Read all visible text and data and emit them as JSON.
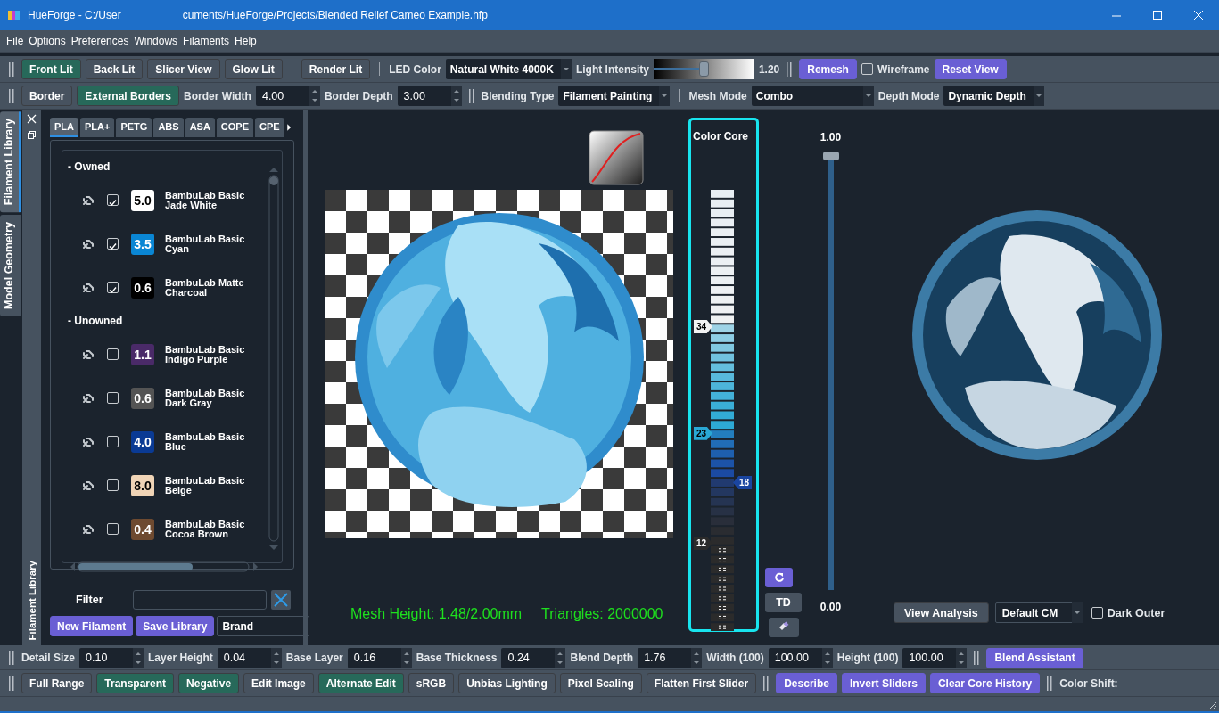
{
  "window": {
    "title": "HueForge - C:/User",
    "title_tail": "cuments/HueForge/Projects/Blended Relief Cameo Example.hfp"
  },
  "menu": [
    "File",
    "Options",
    "Preferences",
    "Windows",
    "Filaments",
    "Help"
  ],
  "view_toolbar": [
    {
      "kind": "grip"
    },
    {
      "kind": "toggle",
      "label": "Front Lit",
      "on": true
    },
    {
      "kind": "toggle",
      "label": "Back Lit",
      "on": false
    },
    {
      "kind": "toggle",
      "label": "Slicer View",
      "on": false
    },
    {
      "kind": "toggle",
      "label": "Glow Lit",
      "on": false
    },
    {
      "kind": "sep"
    },
    {
      "kind": "toggle",
      "label": "Render Lit",
      "on": false
    },
    {
      "kind": "sep"
    },
    {
      "kind": "label",
      "text": "LED Color"
    },
    {
      "kind": "dropdown",
      "value": "Natural White 4000K"
    },
    {
      "kind": "label",
      "text": "Light Intensity"
    },
    {
      "kind": "slider",
      "level": 0.5
    },
    {
      "kind": "label",
      "text": "1.20"
    },
    {
      "kind": "grip"
    },
    {
      "kind": "action",
      "label": "Remesh"
    },
    {
      "kind": "checkbox",
      "label": "Wireframe",
      "checked": false
    },
    {
      "kind": "action",
      "label": "Reset View"
    }
  ],
  "mesh_toolbar": [
    {
      "kind": "grip"
    },
    {
      "kind": "toggle",
      "label": "Border",
      "on": false
    },
    {
      "kind": "toggle",
      "label": "External Borders",
      "on": true
    },
    {
      "kind": "label",
      "text": "Border Width"
    },
    {
      "kind": "spin",
      "value": "4.00"
    },
    {
      "kind": "label",
      "text": "Border Depth"
    },
    {
      "kind": "spin",
      "value": "3.00"
    },
    {
      "kind": "grip"
    },
    {
      "kind": "label",
      "text": "Blending Type"
    },
    {
      "kind": "dropdown",
      "value": "Filament Painting"
    },
    {
      "kind": "sep"
    },
    {
      "kind": "label",
      "text": "Mesh Mode"
    },
    {
      "kind": "dropdown",
      "value": "Combo"
    },
    {
      "kind": "label",
      "text": "Depth Mode"
    },
    {
      "kind": "dropdown",
      "value": "Dynamic Depth"
    }
  ],
  "dock": {
    "tabs": [
      {
        "label": "Filament Library",
        "selected": true
      },
      {
        "label": "Model Geometry",
        "selected": false
      }
    ],
    "title": "Filament Library"
  },
  "filaments": {
    "types": [
      {
        "label": "PLA",
        "selected": true
      },
      {
        "label": "PLA+",
        "selected": false
      },
      {
        "label": "PETG",
        "selected": false
      },
      {
        "label": "ABS",
        "selected": false
      },
      {
        "label": "ASA",
        "selected": false
      },
      {
        "label": "COPE",
        "selected": false
      },
      {
        "label": "CPE",
        "selected": false
      }
    ],
    "groups": [
      {
        "label": "- Owned",
        "items": [
          {
            "td": "5.0",
            "color": "#ffffff",
            "brand": "BambuLab Basic",
            "name": "Jade White",
            "owned": true
          },
          {
            "td": "3.5",
            "color": "#0a86d4",
            "brand": "BambuLab Basic",
            "name": "Cyan",
            "owned": true
          },
          {
            "td": "0.6",
            "color": "#000000",
            "brand": "BambuLab Matte",
            "name": "Charcoal",
            "owned": true
          }
        ]
      },
      {
        "label": "- Unowned",
        "items": [
          {
            "td": "1.1",
            "color": "#4a2a68",
            "brand": "BambuLab Basic",
            "name": "Indigo Purple",
            "owned": false
          },
          {
            "td": "0.6",
            "color": "#545454",
            "brand": "BambuLab Basic",
            "name": "Dark Gray",
            "owned": false
          },
          {
            "td": "4.0",
            "color": "#0a3a94",
            "brand": "BambuLab Basic",
            "name": "Blue",
            "owned": false
          },
          {
            "td": "8.0",
            "color": "#f0d4b6",
            "brand": "BambuLab Basic",
            "name": "Beige",
            "owned": false
          },
          {
            "td": "0.4",
            "color": "#6e4a30",
            "brand": "BambuLab Basic",
            "name": "Cocoa Brown",
            "owned": false
          }
        ]
      }
    ],
    "filter_label": "Filter",
    "buttons": [
      "New Filament",
      "Save Library"
    ],
    "brand": "Brand"
  },
  "preview": {
    "mesh_height": "Mesh Height: 1.48/2.00mm",
    "triangles": "Triangles: 2000000"
  },
  "color_core": {
    "title": "Color Core",
    "markers": [
      {
        "label": "34",
        "color": "#f2f2f2",
        "level": 0.69,
        "kind": "left"
      },
      {
        "label": "23",
        "color": "#2aa8d5",
        "level": 0.449,
        "kind": "left"
      },
      {
        "label": "18",
        "color": "#1a45a0",
        "level": 0.338,
        "kind": "right"
      },
      {
        "label": "12",
        "color": "#2b2b2b",
        "level": 0.201,
        "kind": "left"
      }
    ],
    "td_button": "TD"
  },
  "height_slider": {
    "max": "1.00",
    "min": "0.00",
    "level": 1
  },
  "analysis": {
    "button": "View Analysis",
    "colormap": "Default CM",
    "dark_outer": {
      "label": "Dark Outer",
      "checked": false
    }
  },
  "size_toolbar": [
    {
      "kind": "grip"
    },
    {
      "kind": "label",
      "text": "Detail Size"
    },
    {
      "kind": "spin",
      "value": "0.10"
    },
    {
      "kind": "label",
      "text": "Layer Height"
    },
    {
      "kind": "spin",
      "value": "0.04"
    },
    {
      "kind": "label",
      "text": "Base Layer"
    },
    {
      "kind": "spin",
      "value": "0.16"
    },
    {
      "kind": "label",
      "text": "Base Thickness"
    },
    {
      "kind": "spin",
      "value": "0.24"
    },
    {
      "kind": "label",
      "text": "Blend Depth"
    },
    {
      "kind": "spin",
      "value": "1.76"
    },
    {
      "kind": "label",
      "text": "Width (100)"
    },
    {
      "kind": "spin",
      "value": "100.00"
    },
    {
      "kind": "label",
      "text": "Height (100)"
    },
    {
      "kind": "spin",
      "value": "100.00"
    },
    {
      "kind": "grip"
    },
    {
      "kind": "action",
      "label": "Blend Assistant"
    }
  ],
  "options_toolbar": [
    {
      "kind": "grip"
    },
    {
      "kind": "toggle",
      "label": "Full Range",
      "on": false
    },
    {
      "kind": "toggle",
      "label": "Transparent",
      "on": true
    },
    {
      "kind": "toggle",
      "label": "Negative",
      "on": true
    },
    {
      "kind": "toggle",
      "label": "Edit Image",
      "on": false
    },
    {
      "kind": "toggle",
      "label": "Alternate Edit",
      "on": true
    },
    {
      "kind": "toggle",
      "label": "sRGB",
      "on": false
    },
    {
      "kind": "toggle",
      "label": "Unbias Lighting",
      "on": false
    },
    {
      "kind": "toggle",
      "label": "Pixel Scaling",
      "on": false
    },
    {
      "kind": "toggle",
      "label": "Flatten First Slider",
      "on": false
    },
    {
      "kind": "grip"
    },
    {
      "kind": "action",
      "label": "Describe"
    },
    {
      "kind": "action",
      "label": "Invert Sliders"
    },
    {
      "kind": "action",
      "label": "Clear Core History"
    },
    {
      "kind": "grip"
    },
    {
      "kind": "label",
      "text": "Color Shift:"
    }
  ]
}
